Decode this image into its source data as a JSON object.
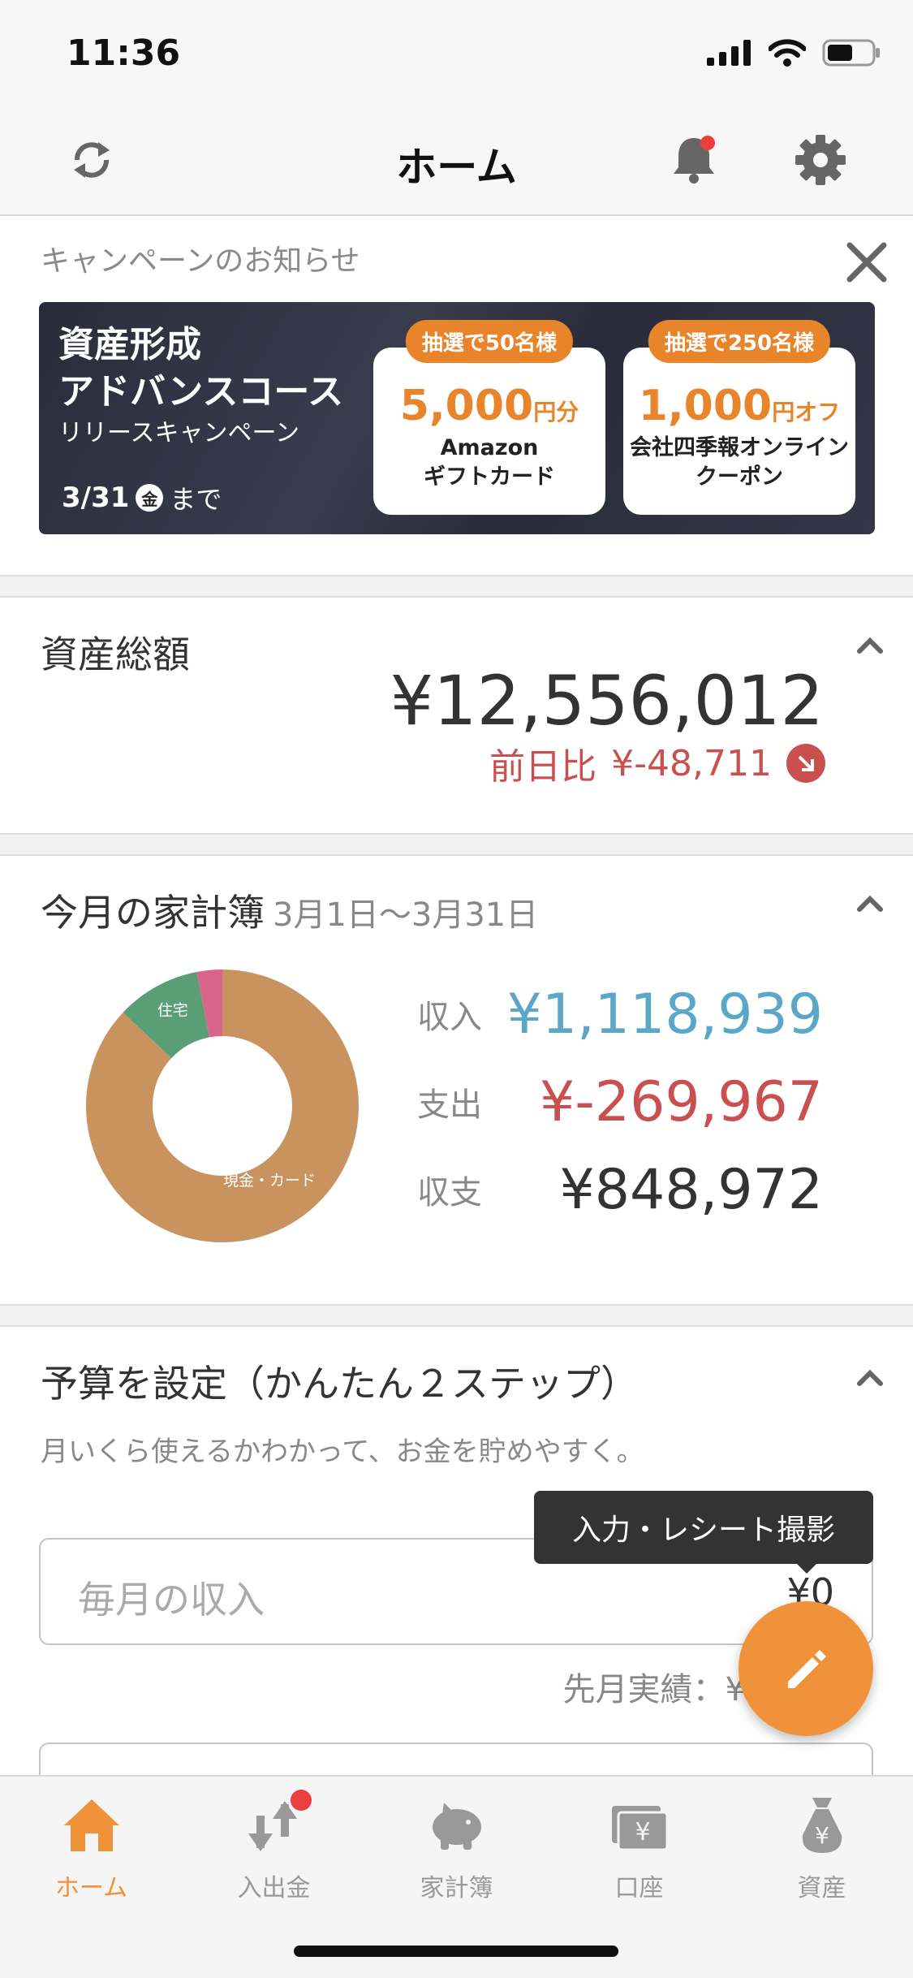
{
  "status_bar": {
    "time": "11:36"
  },
  "header": {
    "title": "ホーム"
  },
  "campaign": {
    "label": "キャンペーンのお知らせ",
    "title_line1": "資産形成",
    "title_line2": "アドバンスコース",
    "subtitle": "リリースキャンペーン",
    "date": "3/31",
    "weekday": "金",
    "until": "まで",
    "prizes": [
      {
        "tag": "抽選で50名様",
        "amount": "5,000",
        "unit": "円分",
        "desc1": "Amazon",
        "desc2": "ギフトカード"
      },
      {
        "tag": "抽選で250名様",
        "amount": "1,000",
        "unit": "円オフ",
        "desc1": "会社四季報オンライン",
        "desc2": "クーポン"
      }
    ]
  },
  "assets": {
    "title": "資産総額",
    "total": "¥12,556,012",
    "diff_label": "前日比",
    "diff_value": "¥-48,711"
  },
  "household": {
    "title": "今月の家計簿",
    "period": "3月1日〜3月31日",
    "donut": [
      {
        "label": "現金・カード",
        "value": 0.87,
        "color": "#c9935f"
      },
      {
        "label": "住宅",
        "value": 0.1,
        "color": "#5a9e76"
      },
      {
        "label": "",
        "value": 0.03,
        "color": "#d9648c"
      }
    ],
    "rows": [
      {
        "label": "収入",
        "value": "¥1,118,939",
        "color": "#5ba7c8"
      },
      {
        "label": "支出",
        "value": "¥-269,967",
        "color": "#c9504f"
      },
      {
        "label": "収支",
        "value": "¥848,972",
        "color": "#333333"
      }
    ]
  },
  "budget": {
    "title": "予算を設定（かんたん２ステップ）",
    "subtitle": "月いくら使えるかわかって、お金を貯めやすく。",
    "income_placeholder": "毎月の収入",
    "income_value": "¥0",
    "last_month": "先月実績：¥"
  },
  "tooltip": "入力・レシート撮影",
  "tabs": [
    {
      "label": "ホーム",
      "icon": "home-icon"
    },
    {
      "label": "入出金",
      "icon": "transfer-icon"
    },
    {
      "label": "家計簿",
      "icon": "piggy-bank-icon"
    },
    {
      "label": "口座",
      "icon": "account-icon"
    },
    {
      "label": "資産",
      "icon": "money-bag-icon"
    }
  ],
  "colors": {
    "accent": "#f0923a",
    "negative": "#c9504f",
    "income": "#5ba7c8"
  }
}
